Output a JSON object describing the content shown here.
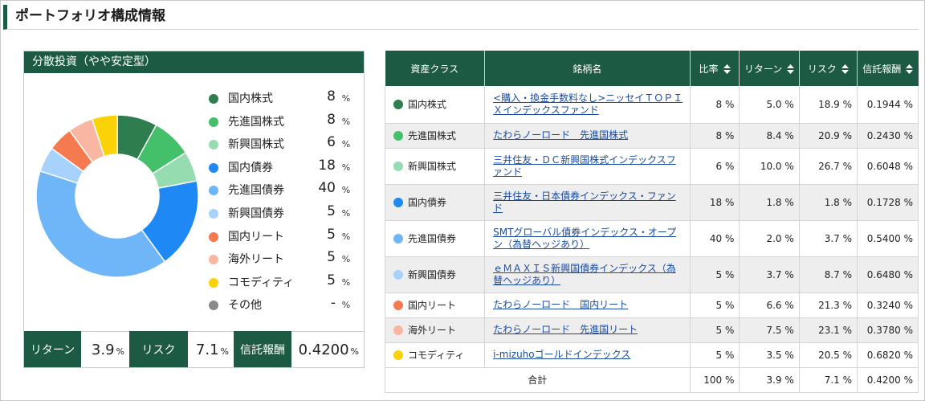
{
  "page": {
    "title": "ポートフォリオ構成情報"
  },
  "allocation": {
    "title": "分散投資（やや安定型）",
    "percent_unit": "%",
    "items": [
      {
        "name": "国内株式",
        "value": "8",
        "percent": 8,
        "color": "#2e7d4f"
      },
      {
        "name": "先進国株式",
        "value": "8",
        "percent": 8,
        "color": "#45c06a"
      },
      {
        "name": "新興国株式",
        "value": "6",
        "percent": 6,
        "color": "#95dcb0"
      },
      {
        "name": "国内債券",
        "value": "18",
        "percent": 18,
        "color": "#1e88f5"
      },
      {
        "name": "先進国債券",
        "value": "40",
        "percent": 40,
        "color": "#6fb6f9"
      },
      {
        "name": "新興国債券",
        "value": "5",
        "percent": 5,
        "color": "#a7d2fb"
      },
      {
        "name": "国内リート",
        "value": "5",
        "percent": 5,
        "color": "#f67a4f"
      },
      {
        "name": "海外リート",
        "value": "5",
        "percent": 5,
        "color": "#f9b6a2"
      },
      {
        "name": "コモディティ",
        "value": "5",
        "percent": 5,
        "color": "#fbd108"
      },
      {
        "name": "その他",
        "value": "-",
        "percent": 0,
        "color": "#8a8a8a"
      }
    ],
    "stats": {
      "return_label": "リターン",
      "return_value": "3.9",
      "risk_label": "リスク",
      "risk_value": "7.1",
      "fee_label": "信託報酬",
      "fee_value": "0.4200"
    }
  },
  "table": {
    "headers": {
      "asset_class": "資産クラス",
      "fund": "銘柄名",
      "ratio": "比率",
      "return": "リターン",
      "risk": "リスク",
      "fee": "信託報酬"
    },
    "rows": [
      {
        "asset_class": "国内株式",
        "color": "#2e7d4f",
        "fund": "<購入・換金手数料なし>ニッセイＴＯＰＩＸインデックスファンド",
        "ratio": "8 %",
        "return": "5.0 %",
        "risk": "18.9 %",
        "fee": "0.1944 %"
      },
      {
        "asset_class": "先進国株式",
        "color": "#45c06a",
        "fund": "たわらノーロード　先進国株式",
        "ratio": "8 %",
        "return": "8.4 %",
        "risk": "20.9 %",
        "fee": "0.2430 %"
      },
      {
        "asset_class": "新興国株式",
        "color": "#95dcb0",
        "fund": "三井住友・ＤＣ新興国株式インデックスファンド",
        "ratio": "6 %",
        "return": "10.0 %",
        "risk": "26.7 %",
        "fee": "0.6048 %"
      },
      {
        "asset_class": "国内債券",
        "color": "#1e88f5",
        "fund": "三井住友・日本債券インデックス・ファンド",
        "ratio": "18 %",
        "return": "1.8 %",
        "risk": "1.8 %",
        "fee": "0.1728 %"
      },
      {
        "asset_class": "先進国債券",
        "color": "#6fb6f9",
        "fund": "SMTグローバル債券インデックス・オープン（為替ヘッジあり）",
        "ratio": "40 %",
        "return": "2.0 %",
        "risk": "3.7 %",
        "fee": "0.5400 %"
      },
      {
        "asset_class": "新興国債券",
        "color": "#a7d2fb",
        "fund": "ｅＭＡＸＩＳ新興国債券インデックス（為替ヘッジあり）",
        "ratio": "5 %",
        "return": "3.7 %",
        "risk": "8.7 %",
        "fee": "0.6480 %"
      },
      {
        "asset_class": "国内リート",
        "color": "#f67a4f",
        "fund": "たわらノーロード　国内リート",
        "ratio": "5 %",
        "return": "6.6 %",
        "risk": "21.3 %",
        "fee": "0.3240 %"
      },
      {
        "asset_class": "海外リート",
        "color": "#f9b6a2",
        "fund": "たわらノーロード　先進国リート",
        "ratio": "5 %",
        "return": "7.5 %",
        "risk": "23.1 %",
        "fee": "0.3780 %"
      },
      {
        "asset_class": "コモディティ",
        "color": "#fbd108",
        "fund": "i-mizuhoゴールドインデックス",
        "ratio": "5 %",
        "return": "3.5 %",
        "risk": "20.5 %",
        "fee": "0.6820 %"
      }
    ],
    "total": {
      "label": "合計",
      "ratio": "100 %",
      "return": "3.9 %",
      "risk": "7.1 %",
      "fee": "0.4200 %"
    }
  }
}
